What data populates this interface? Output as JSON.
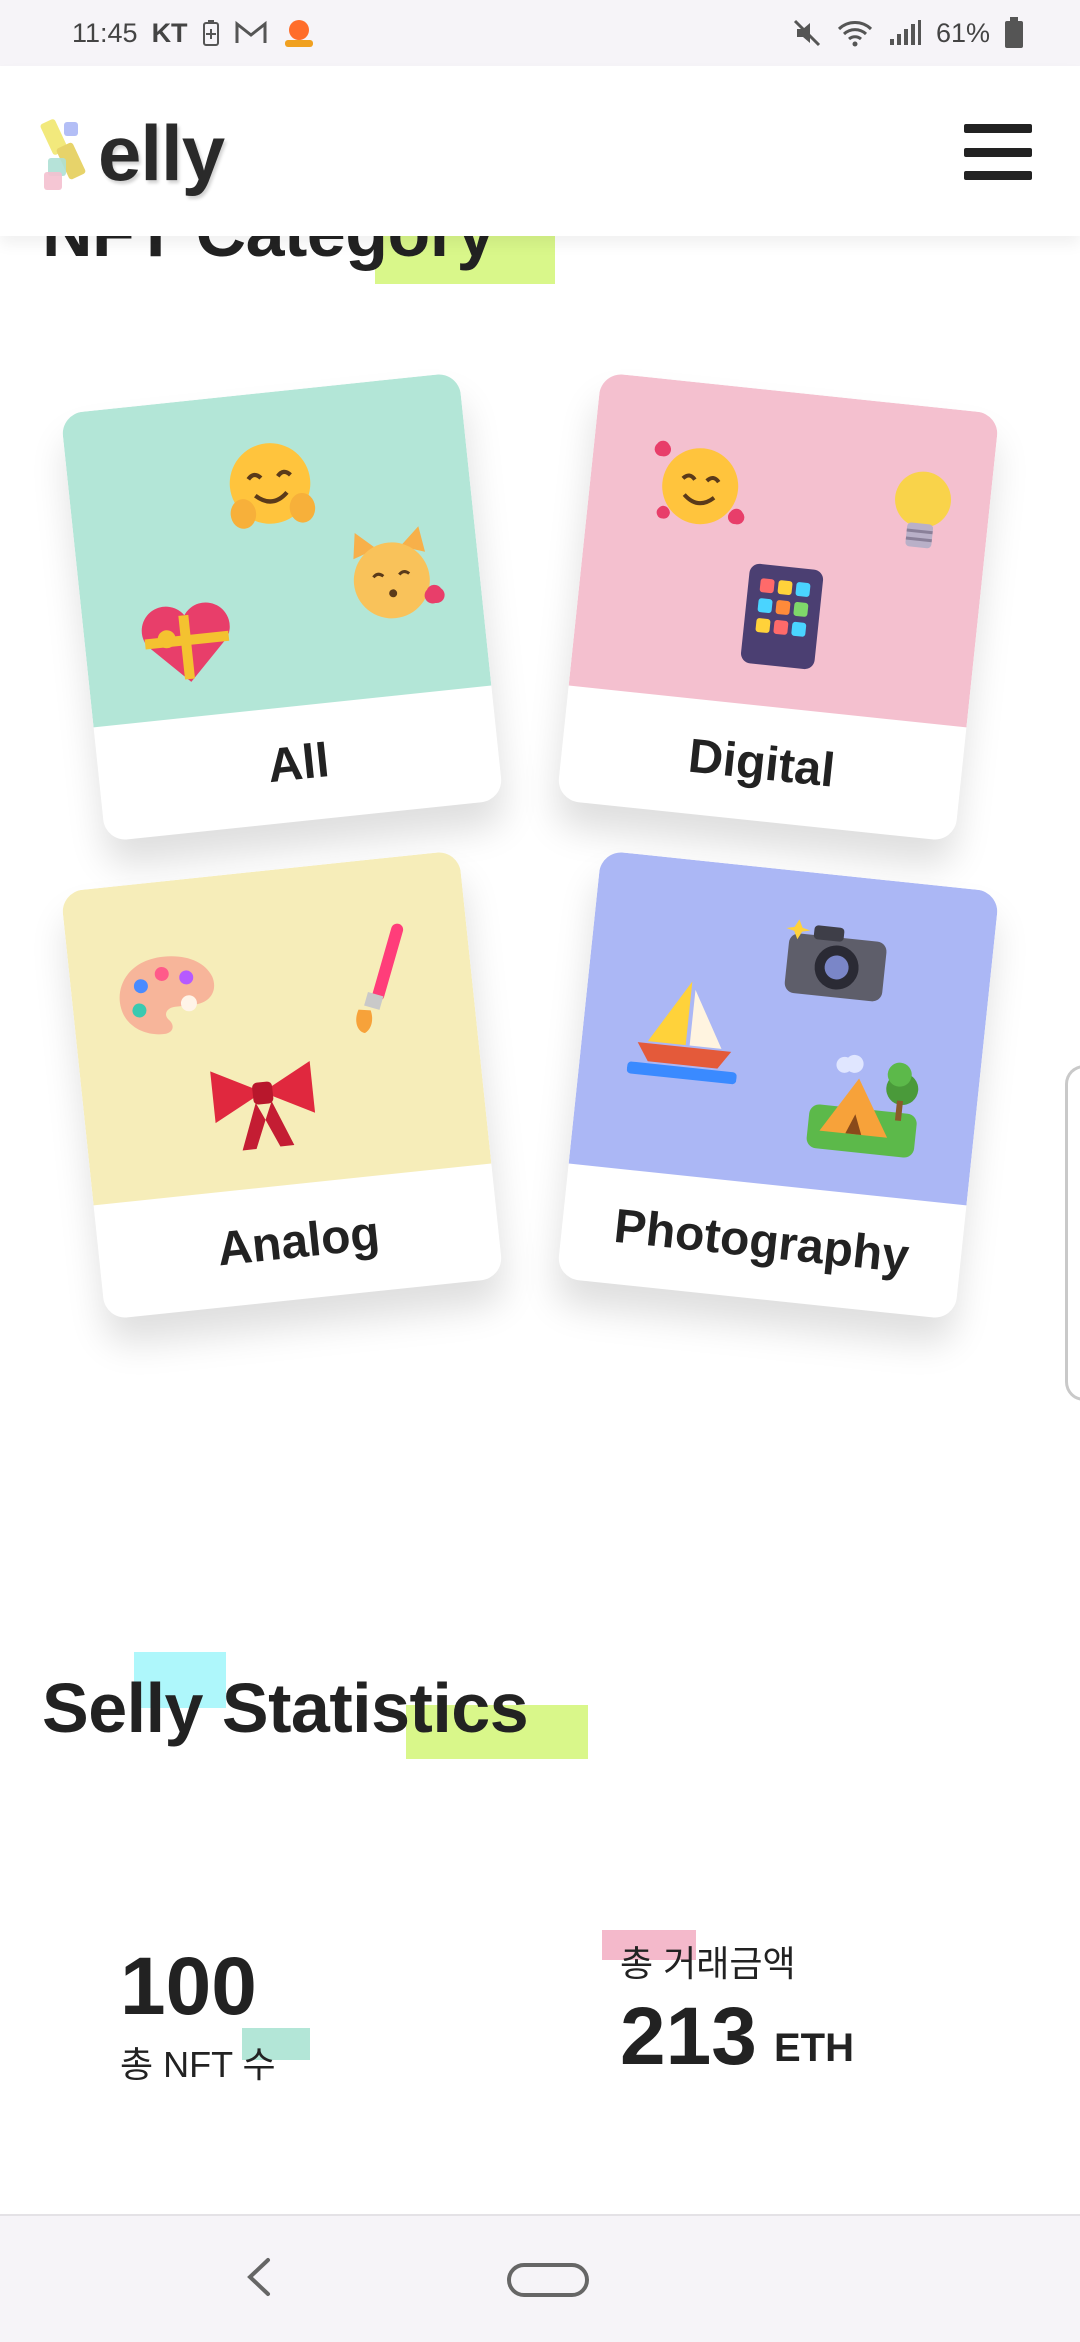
{
  "status_bar": {
    "time": "11:45",
    "carrier": "KT",
    "battery": "61%",
    "icons": [
      "battery-saver-icon",
      "gmail-icon",
      "app-notification-icon",
      "mute-icon",
      "wifi-icon",
      "signal-icon",
      "battery-icon"
    ]
  },
  "header": {
    "logo_text": "elly",
    "menu_icon": "hamburger-menu-icon"
  },
  "category_section": {
    "title": "NFT Category",
    "cards": [
      {
        "label": "All",
        "color": "#b3e6d7",
        "icons": [
          "hugging-face-emoji",
          "gift-heart-emoji",
          "kissing-cat-emoji"
        ]
      },
      {
        "label": "Digital",
        "color": "#f4c0cf",
        "icons": [
          "smiling-hearts-emoji",
          "light-bulb-emoji",
          "tablet-emoji"
        ]
      },
      {
        "label": "Analog",
        "color": "#f6edb9",
        "icons": [
          "palette-emoji",
          "paintbrush-emoji",
          "ribbon-emoji"
        ]
      },
      {
        "label": "Photography",
        "color": "#abb7f5",
        "icons": [
          "sailboat-emoji",
          "camera-emoji",
          "camping-emoji"
        ]
      }
    ]
  },
  "statistics_section": {
    "title": "Selly Statistics",
    "nft_count": {
      "value": "100",
      "label": "총 NFT 수"
    },
    "trade_amount": {
      "label": "총 거래금액",
      "value": "213",
      "unit": "ETH"
    }
  },
  "colors": {
    "highlight_lime": "#d9f78a",
    "highlight_cyan": "#aef7fb",
    "highlight_pink": "#f4b9cb",
    "highlight_mint": "#b3e6d7"
  },
  "nav_bar": {
    "icons": [
      "back-icon",
      "home-icon"
    ]
  }
}
